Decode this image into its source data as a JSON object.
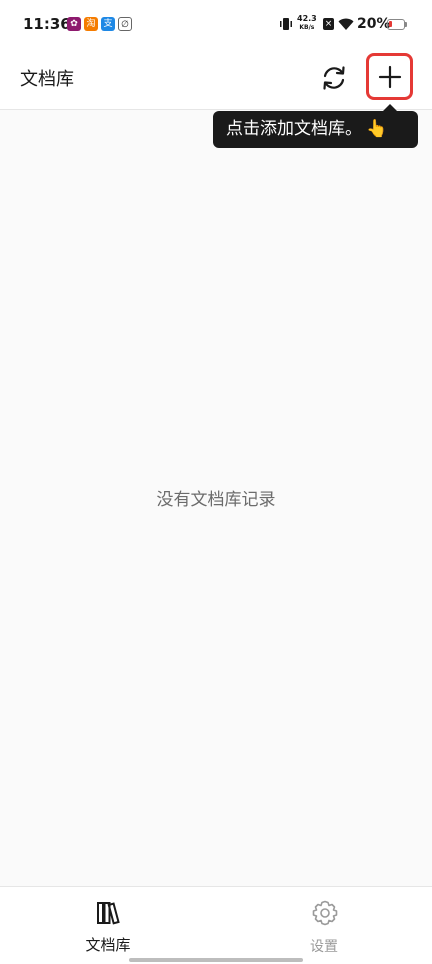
{
  "status_bar": {
    "time": "11:36",
    "net_speed_value": "42.3",
    "net_speed_unit": "KB/s",
    "battery_percent": "20%",
    "battery_level": 0.2,
    "colors": {
      "battery_low": "#e53935"
    }
  },
  "header": {
    "title": "文档库",
    "refresh_icon": "refresh-icon",
    "add_icon": "plus-icon",
    "colors": {
      "highlight_border": "#e53935"
    }
  },
  "tooltip": {
    "text": "点击添加文档库。",
    "emoji": "👆"
  },
  "main": {
    "empty_message": "没有文档库记录"
  },
  "bottom_nav": {
    "items": [
      {
        "label": "文档库",
        "icon": "library-icon",
        "active": true
      },
      {
        "label": "设置",
        "icon": "gear-icon",
        "active": false
      }
    ]
  }
}
